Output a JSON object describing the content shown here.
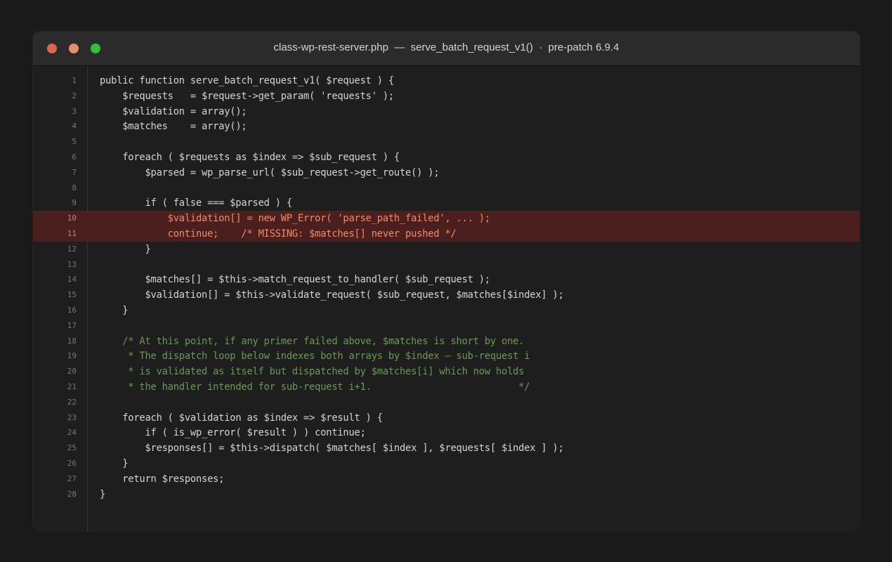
{
  "window": {
    "title": "class-wp-rest-server.php  —  serve_batch_request_v1()  ·  pre-patch 6.9.4",
    "traffic_lights": [
      {
        "name": "close",
        "color": "#e0654f"
      },
      {
        "name": "minimize",
        "color": "#e88e6a"
      },
      {
        "name": "zoom",
        "color": "#2fc237"
      }
    ]
  },
  "editor": {
    "highlight_color": "#4b1f1d",
    "comment_color": "#6a9955",
    "lines": [
      {
        "num": "1",
        "text": "public function serve_batch_request_v1( $request ) {",
        "kind": "code"
      },
      {
        "num": "2",
        "text": "    $requests   = $request->get_param( 'requests' );",
        "kind": "code"
      },
      {
        "num": "3",
        "text": "    $validation = array();",
        "kind": "code"
      },
      {
        "num": "4",
        "text": "    $matches    = array();",
        "kind": "code"
      },
      {
        "num": "5",
        "text": "",
        "kind": "code"
      },
      {
        "num": "6",
        "text": "    foreach ( $requests as $index => $sub_request ) {",
        "kind": "code"
      },
      {
        "num": "7",
        "text": "        $parsed = wp_parse_url( $sub_request->get_route() );",
        "kind": "code"
      },
      {
        "num": "8",
        "text": "",
        "kind": "code"
      },
      {
        "num": "9",
        "text": "        if ( false === $parsed ) {",
        "kind": "code"
      },
      {
        "num": "10",
        "text": "            $validation[] = new WP_Error( 'parse_path_failed', ... );",
        "kind": "highlight"
      },
      {
        "num": "11",
        "text": "            continue;    /* MISSING: $matches[] never pushed */",
        "kind": "highlight"
      },
      {
        "num": "12",
        "text": "        }",
        "kind": "code"
      },
      {
        "num": "13",
        "text": "",
        "kind": "code"
      },
      {
        "num": "14",
        "text": "        $matches[] = $this->match_request_to_handler( $sub_request );",
        "kind": "code"
      },
      {
        "num": "15",
        "text": "        $validation[] = $this->validate_request( $sub_request, $matches[$index] );",
        "kind": "code"
      },
      {
        "num": "16",
        "text": "    }",
        "kind": "code"
      },
      {
        "num": "17",
        "text": "",
        "kind": "code"
      },
      {
        "num": "18",
        "text": "    /* At this point, if any primer failed above, $matches is short by one.",
        "kind": "comment"
      },
      {
        "num": "19",
        "text": "     * The dispatch loop below indexes both arrays by $index — sub-request i",
        "kind": "comment"
      },
      {
        "num": "20",
        "text": "     * is validated as itself but dispatched by $matches[i] which now holds",
        "kind": "comment"
      },
      {
        "num": "21",
        "text": "     * the handler intended for sub-request i+1.                          */",
        "kind": "comment"
      },
      {
        "num": "22",
        "text": "",
        "kind": "code"
      },
      {
        "num": "23",
        "text": "    foreach ( $validation as $index => $result ) {",
        "kind": "code"
      },
      {
        "num": "24",
        "text": "        if ( is_wp_error( $result ) ) continue;",
        "kind": "code"
      },
      {
        "num": "25",
        "text": "        $responses[] = $this->dispatch( $matches[ $index ], $requests[ $index ] );",
        "kind": "code"
      },
      {
        "num": "26",
        "text": "    }",
        "kind": "code"
      },
      {
        "num": "27",
        "text": "    return $responses;",
        "kind": "code"
      },
      {
        "num": "28",
        "text": "}",
        "kind": "code"
      }
    ]
  }
}
